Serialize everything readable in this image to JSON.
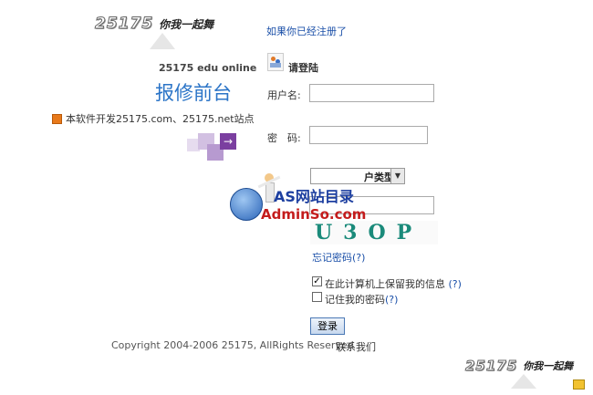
{
  "header": {
    "logo_number": "25175",
    "logo_slogan": "你我一起舞",
    "subtitle": "25175 edu online",
    "title": "报修前台",
    "dev_note": "本软件开发25175.com、25175.net站点"
  },
  "login": {
    "registered_link": "如果你已经注册了",
    "heading": "请登陆",
    "username_label": "用户名:",
    "password_label": "密　码:",
    "type_select_label": "户类型",
    "captcha_code": "U3OP",
    "forgot_password": "忘记密码",
    "help_mark": "(?)",
    "remember_info_label": "在此计算机上保留我的信息",
    "remember_info_checked": true,
    "remember_password_label": "记住我的密码",
    "remember_password_checked": false,
    "login_button": "登录"
  },
  "watermark": {
    "line1": "AS网站目录",
    "line2": "AdminSo.com"
  },
  "footer": {
    "copyright": "Copyright 2004-2006 25175, AllRights Reserved",
    "contact": "联系我们"
  },
  "colors": {
    "link_blue": "#1a4fa8",
    "title_blue": "#2b74c7",
    "purple": "#7b3fa0"
  }
}
